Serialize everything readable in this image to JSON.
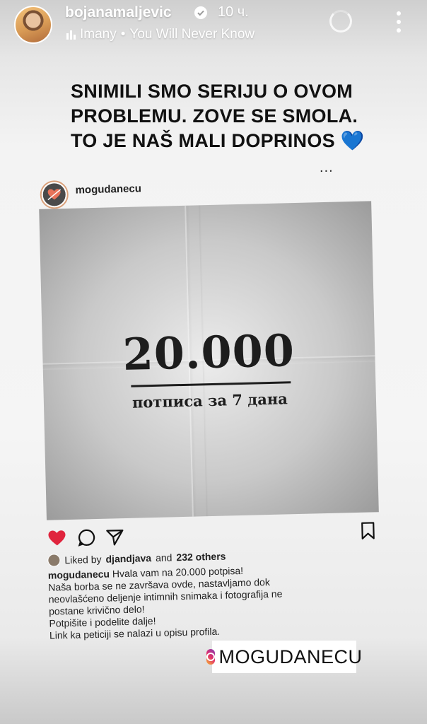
{
  "story": {
    "username": "bojanamaljevic",
    "time": "10 ч.",
    "music_artist": "Imany",
    "music_separator": "•",
    "music_title": "You Will Never Know"
  },
  "caption": {
    "lines": [
      "SNIMILI SMO SERIJU O OVOM",
      "PROBLEMU. ZOVE SE SMOLA.",
      "TO JE NAŠ MALI DOPRINOS 💙"
    ]
  },
  "post": {
    "dots": "...",
    "username": "mogudanecu",
    "poster_number": "20.000",
    "poster_subtitle": "потписа за 7 дана",
    "liked_prefix": "Liked by",
    "liked_user": "djandjava",
    "liked_and": "and",
    "liked_others": "232 others",
    "caption_user": "mogudanecu",
    "caption_lines": [
      "Hvala vam na 20.000 potpisa!",
      "Naša borba se ne završava ovde, nastavljamo dok",
      "neovlašćeno deljenje intimnih snimaka i fotografija ne",
      "postane krivično delo!",
      "Potpišite i podelite dalje!",
      "Link ka peticiji se nalazi u opisu profila."
    ],
    "heart_color": "#e0243d"
  },
  "mention": {
    "label": "MOGUDANECU"
  }
}
